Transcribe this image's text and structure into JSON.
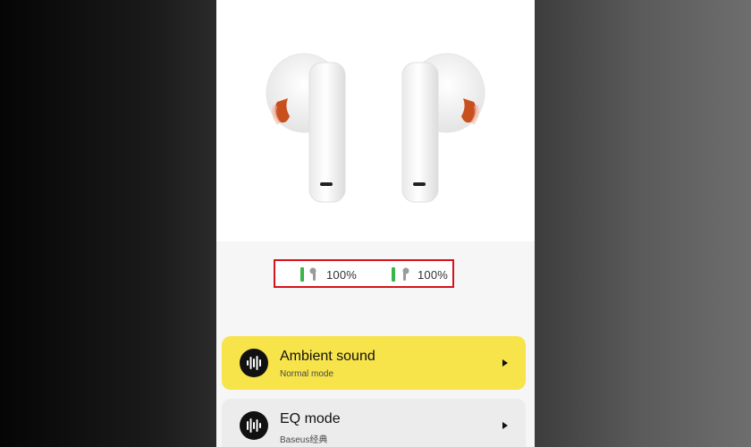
{
  "battery": {
    "left": {
      "percent_label": "100%",
      "level": 1.0,
      "icon": "earbud-left-icon"
    },
    "right": {
      "percent_label": "100%",
      "level": 1.0,
      "icon": "earbud-right-icon"
    },
    "highlight_color": "#d6131c",
    "bar_color": "#39b54a"
  },
  "cards": {
    "ambient": {
      "title": "Ambient sound",
      "subtitle": "Normal mode",
      "icon": "sound-wave-icon",
      "color": "#f7e34a"
    },
    "eq": {
      "title": "EQ mode",
      "subtitle": "Baseus经典",
      "icon": "equalizer-icon",
      "color": "#ececec"
    }
  },
  "image": {
    "subject": "earbuds-image",
    "accent_color": "#c8501e"
  }
}
